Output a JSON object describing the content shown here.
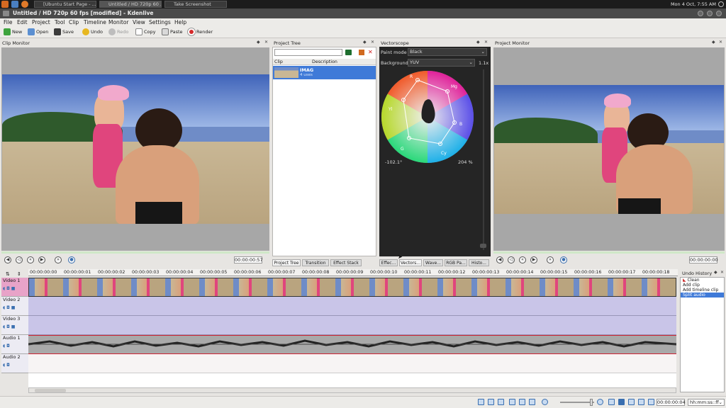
{
  "taskbar": {
    "tasks": [
      "[Ubuntu Start Page - ...",
      "Untitled / HD 720p 60 ...",
      "Take Screenshot"
    ],
    "clock": "Mon  4 Oct,  7:55 AM"
  },
  "window": {
    "title": "Untitled / HD 720p 60 fps [modified] - Kdenlive"
  },
  "menu": [
    "File",
    "Edit",
    "Project",
    "Tool",
    "Clip",
    "Timeline",
    "Monitor",
    "View",
    "Settings",
    "Help"
  ],
  "toolbar": {
    "new": "New",
    "open": "Open",
    "save": "Save",
    "undo": "Undo",
    "redo": "Redo",
    "copy": "Copy",
    "paste": "Paste",
    "render": "Render"
  },
  "clip_monitor": {
    "title": "Clip Monitor",
    "timecode": "00:00:00:57"
  },
  "project_tree": {
    "title": "Project Tree",
    "col_clip": "Clip",
    "col_description": "Description",
    "item_name": "IMAG",
    "item_sub": "4 uses"
  },
  "vectorscope": {
    "title": "Vectorscope",
    "paint_mode_label": "Paint mode",
    "paint_mode_value": "Black",
    "background_label": "Background",
    "background_value": "YUV",
    "zoom": "1.1x",
    "angle": "-102.1°",
    "gain": "204 %",
    "labels": {
      "r": "R",
      "mg": "Mg",
      "b": "B",
      "cy": "Cy",
      "g": "G",
      "yl": "Yl"
    }
  },
  "project_monitor": {
    "title": "Project Monitor",
    "timecode": "00:00:00:00"
  },
  "tabs_left": [
    "Project Tree",
    "Transition",
    "Effect Stack"
  ],
  "tabs_right": [
    "Effec...",
    "Vectors...",
    "Wave...",
    "RGB Pa...",
    "Histo..."
  ],
  "ruler": [
    "00:00:00:00",
    "00:00:00:01",
    "00:00:00:02",
    "00:00:00:03",
    "00:00:00:04",
    "00:00:00:05",
    "00:00:00:06",
    "00:00:00:07",
    "00:00:00:08",
    "00:00:00:09",
    "00:00:00:10",
    "00:00:00:11",
    "00:00:00:12",
    "00:00:00:13",
    "00:00:00:14",
    "00:00:00:15",
    "00:00:00:16",
    "00:00:00:17",
    "00:00:00:18"
  ],
  "tracks": [
    "Video 1",
    "Video 2",
    "Video 3",
    "Audio 1",
    "Audio 2"
  ],
  "undo_history": {
    "title": "Undo History",
    "items": [
      "Clean",
      "Add clip",
      "Add timeline clip",
      "Split audio"
    ],
    "selected_index": 3
  },
  "status": {
    "timecode": "00:00:00:04",
    "format": "hh:mm:ss::ff"
  },
  "colors": {
    "video_track": "#c9c5e8",
    "audio_track": "#a9a9a9",
    "selection": "#3f7ad8"
  }
}
